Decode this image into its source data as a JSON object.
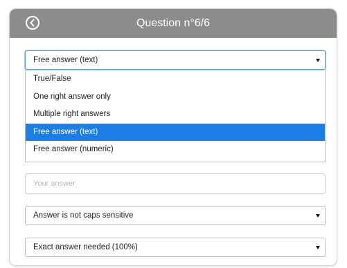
{
  "header": {
    "title": "Question n°6/6"
  },
  "answer_type": {
    "selected": "Free answer (text)",
    "options": [
      "True/False",
      "One right answer only",
      "Multiple right answers",
      "Free answer (text)",
      "Free answer (numeric)"
    ],
    "highlighted_index": 3
  },
  "answer_input": {
    "placeholder": "Your answer"
  },
  "case_select": {
    "selected": "Answer is not caps sensitive"
  },
  "accuracy_select": {
    "selected": "Exact answer needed (100%)"
  },
  "colors": {
    "header": "#8c8c8c",
    "highlight": "#1a7ee6"
  }
}
